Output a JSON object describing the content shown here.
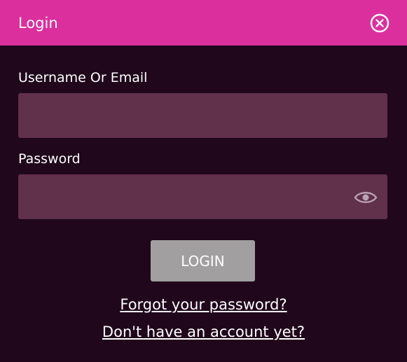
{
  "dialog": {
    "title": "Login"
  },
  "form": {
    "username_label": "Username Or Email",
    "username_value": "",
    "password_label": "Password",
    "password_value": "",
    "login_button": "LOGIN"
  },
  "links": {
    "forgot_password": "Forgot your password?",
    "signup": "Don't have an account yet?"
  },
  "icons": {
    "close": "close-circle-icon",
    "eye": "eye-icon"
  },
  "colors": {
    "header": "#dc2f9e",
    "background": "#20071c",
    "field": "#61304a",
    "button": "#a19fa0"
  }
}
